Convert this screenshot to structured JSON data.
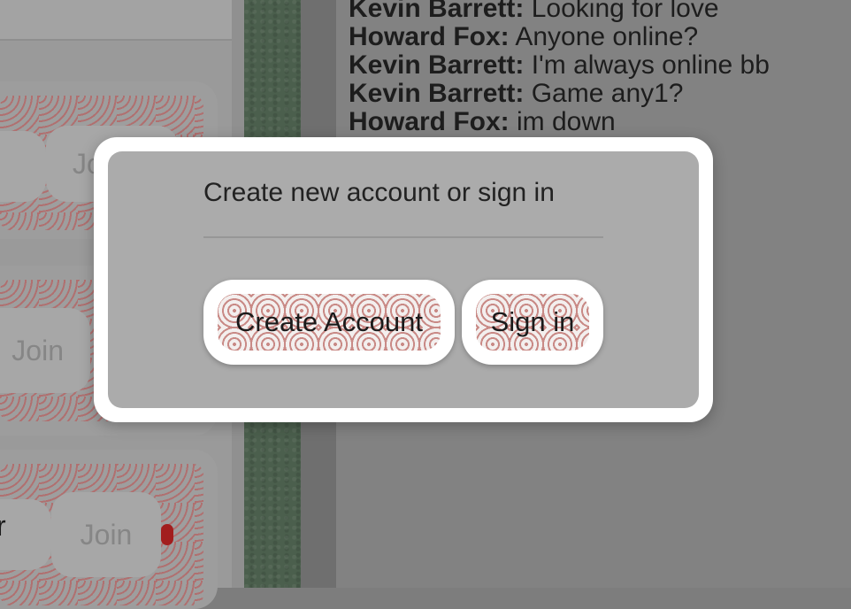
{
  "chat": {
    "messages": [
      {
        "author": "Kevin Barrett:",
        "text": " Looking for love"
      },
      {
        "author": "Howard Fox:",
        "text": " Anyone online?"
      },
      {
        "author": "Kevin Barrett:",
        "text": " I'm always online bb"
      },
      {
        "author": "Kevin Barrett:",
        "text": " Game any1?"
      },
      {
        "author": "Howard Fox:",
        "text": " im down"
      }
    ]
  },
  "lobby": {
    "join_label": "Join",
    "partial_label_top": "Jo",
    "partial_label_bottom": "r"
  },
  "modal": {
    "title": "Create new account or sign in",
    "create_account_label": "Create Account",
    "sign_in_label": "Sign in"
  },
  "colors": {
    "overlay": "#7d7d7d",
    "modal_frame": "#ffffff",
    "modal_body": "#ababab",
    "button_pattern": "#c98a86",
    "status_dot": "#a21e1e",
    "felt": "#4b5f4d"
  }
}
